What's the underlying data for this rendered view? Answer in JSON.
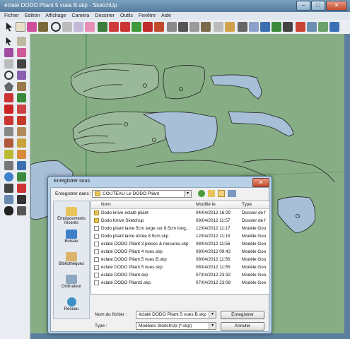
{
  "window": {
    "title": "éclaté DODO Pliant 5 vues B.skp - SketchUp",
    "minimize": "–",
    "maximize": "□",
    "close": "✕"
  },
  "menu": [
    "Fichier",
    "Edition",
    "Affichage",
    "Caméra",
    "Dessiner",
    "Outils",
    "Fenêtre",
    "Aide"
  ],
  "dialog": {
    "title": "Enregistrer sous",
    "close": "✕",
    "save_in_label": "Enregistrer dans :",
    "save_in_value": "COUTEAU Le DODO Pliant",
    "places": [
      "Emplacements récents",
      "Bureau",
      "Bibliothèques",
      "Ordinateur",
      "Réseau"
    ],
    "columns": {
      "name": "Nom",
      "modified": "Modifié le",
      "type": "Type"
    },
    "files": [
      {
        "kind": "folder",
        "name": "Dodo knive éclaté pliant",
        "modified": "04/04/2012 16:29",
        "type": "Dossier de f"
      },
      {
        "kind": "folder",
        "name": "Dodo Knive Sketchup",
        "modified": "08/04/2012 11:57",
        "type": "Dossier de f"
      },
      {
        "kind": "doc",
        "name": "Dodo pliant lame 5cm large sur 8.5cm long...",
        "modified": "12/04/2012 11:17",
        "type": "Modèle Goo"
      },
      {
        "kind": "doc",
        "name": "Dodo pliant lame étirée 8.5cm.skp",
        "modified": "12/04/2012 11:15",
        "type": "Modèle Goo"
      },
      {
        "kind": "doc",
        "name": "éclaté DODO Pliant 3 pièces & mesures.skp",
        "modified": "08/04/2012 11:56",
        "type": "Modèle Goo"
      },
      {
        "kind": "doc",
        "name": "éclaté DODO Pliant 4 vues.skp",
        "modified": "08/04/2012 09:43",
        "type": "Modèle Goo"
      },
      {
        "kind": "doc",
        "name": "éclaté DODO Pliant 5 vues B.skp",
        "modified": "08/04/2012 11:56",
        "type": "Modèle Goo"
      },
      {
        "kind": "doc",
        "name": "éclaté DODO Pliant 5 vues.skp",
        "modified": "08/04/2012 11:55",
        "type": "Modèle Goo"
      },
      {
        "kind": "doc",
        "name": "éclaté DODO Pliant.skp",
        "modified": "07/04/2012 23:32",
        "type": "Modèle Goo"
      },
      {
        "kind": "doc",
        "name": "éclaté DODO Pliant2.skp",
        "modified": "07/04/2012 23:08",
        "type": "Modèle Goo"
      }
    ],
    "filename_label": "Nom du fichier :",
    "filename_value": "éclaté DODO Pliant 5 vues B.skp",
    "type_label": "Type :",
    "type_value": "Modèles SketchUp (*.skp)",
    "save_button": "Enregistrer",
    "cancel_button": "Annuler"
  },
  "colors": {
    "canvas": "#86ad84",
    "window_frame": "#5c7fa0",
    "dialog_frame": "#b9d1e6"
  }
}
